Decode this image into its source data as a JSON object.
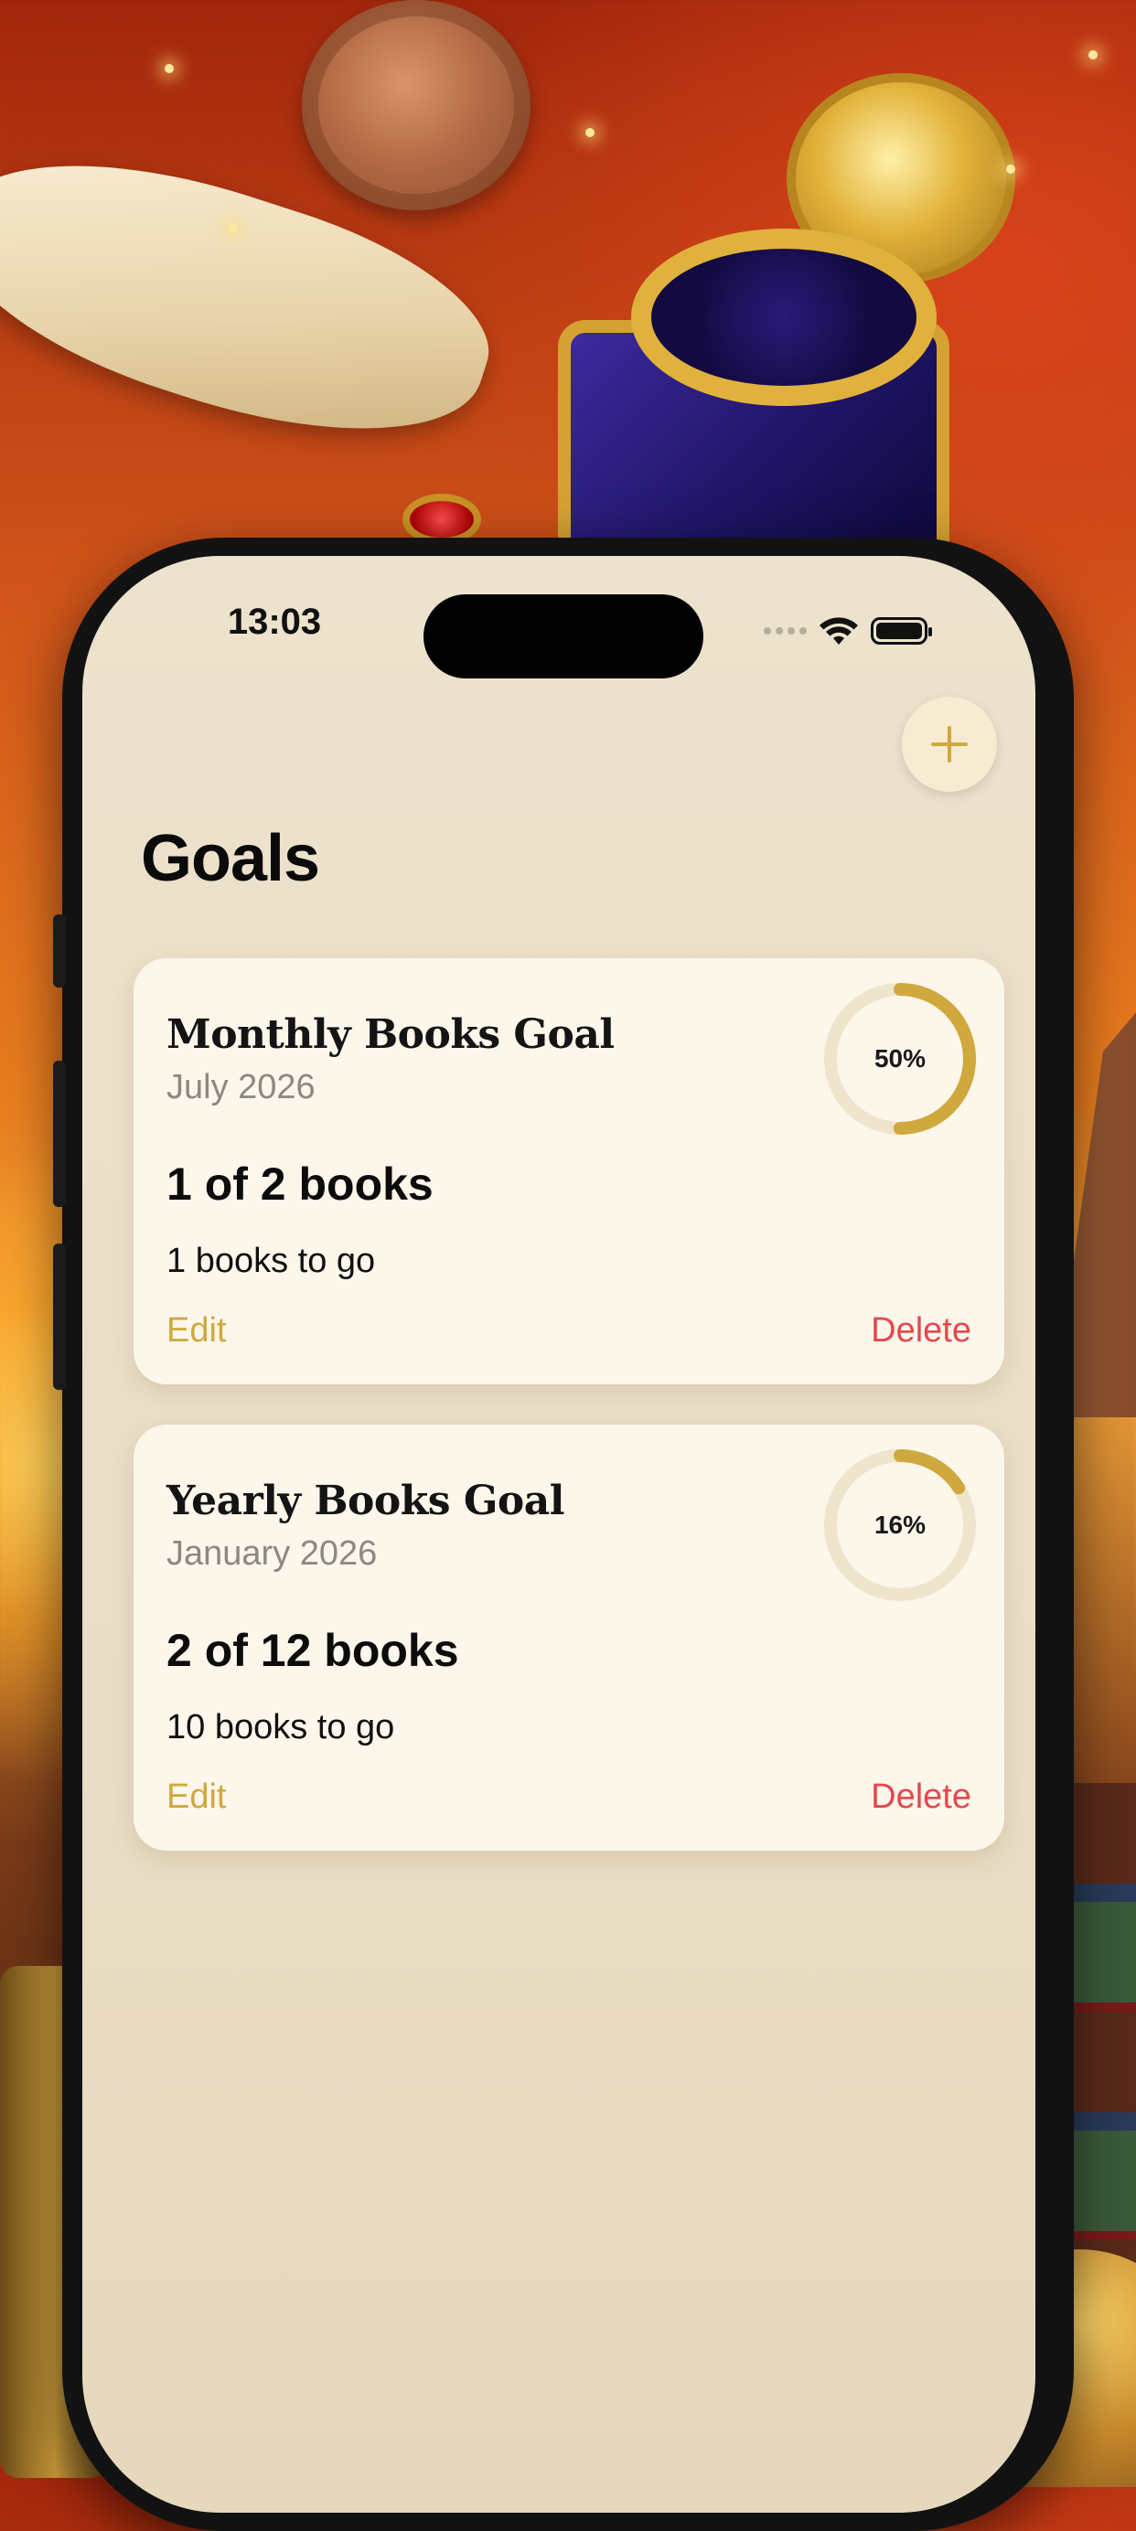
{
  "status_bar": {
    "time": "13:03"
  },
  "header": {
    "title": "Goals",
    "add_icon": "plus-icon"
  },
  "goals": [
    {
      "title": "Monthly Books Goal",
      "period": "July 2026",
      "progress_text": "1 of 2 books",
      "remaining_text": "1 books to go",
      "percent_label": "50%",
      "percent": 50,
      "edit_label": "Edit",
      "delete_label": "Delete"
    },
    {
      "title": "Yearly Books Goal",
      "period": "January 2026",
      "progress_text": "2 of 12 books",
      "remaining_text": "10 books to go",
      "percent_label": "16%",
      "percent": 16,
      "edit_label": "Edit",
      "delete_label": "Delete"
    }
  ],
  "colors": {
    "accent_gold": "#cfa93e",
    "delete_red": "#e4484f",
    "ring_track": "#efe5cc",
    "card_bg": "#fdf6ea",
    "screen_bg": "#ede2cd"
  }
}
